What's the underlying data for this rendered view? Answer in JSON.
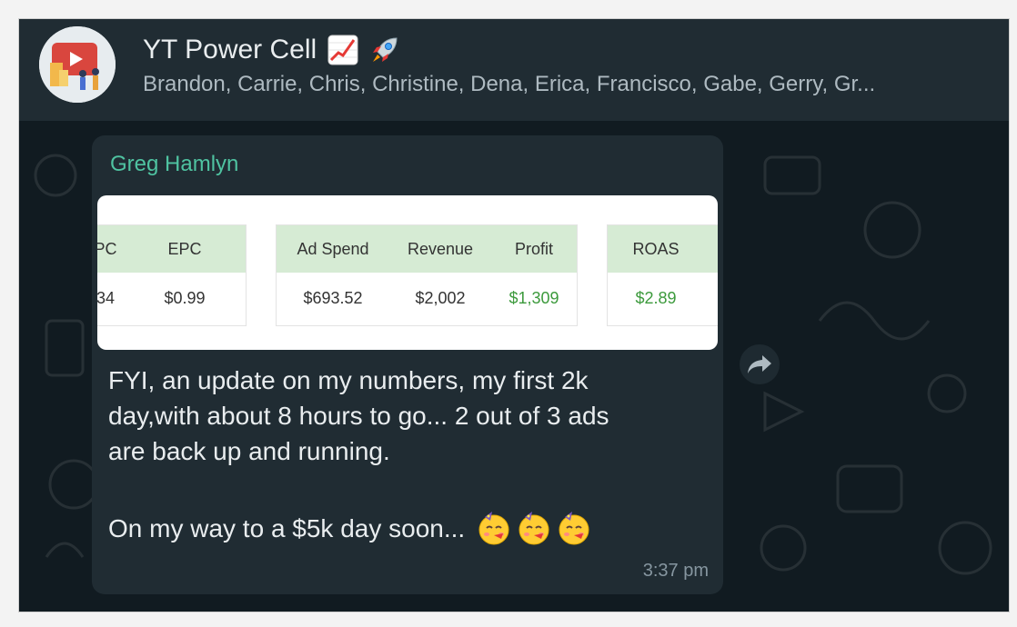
{
  "header": {
    "group_name": "YT Power Cell",
    "title_emojis": [
      "chart-increasing-icon",
      "rocket-icon"
    ],
    "members": "Brandon, Carrie, Chris, Christine, Dena, Erica, Francisco, Gabe, Gerry, Gr..."
  },
  "message": {
    "sender": "Greg Hamlyn",
    "image": {
      "table_left": {
        "headers": [
          "PC",
          "EPC"
        ],
        "values": [
          "34",
          "$0.99"
        ]
      },
      "table_middle": {
        "headers": [
          "Ad Spend",
          "Revenue",
          "Profit"
        ],
        "values": [
          "$693.52",
          "$2,002",
          "$1,309"
        ]
      },
      "table_right": {
        "headers": [
          "ROAS"
        ],
        "values": [
          "$2.89"
        ]
      }
    },
    "text": "FYI, an update on my numbers, my first 2k\nday,with about 8 hours to go...  2 out of 3 ads\nare back up and running.",
    "text_line2": "On my way to a $5k day soon...",
    "emojis": [
      "partying-face-icon",
      "partying-face-icon",
      "partying-face-icon"
    ],
    "time": "3:37 pm"
  },
  "colors": {
    "chat_bg": "#111b21",
    "header_bg": "#202c33",
    "bubble_bg": "#202c33",
    "sender_name": "#4fc3a1",
    "table_header": "#d6ebd4",
    "positive_value": "#3c9a3c"
  }
}
